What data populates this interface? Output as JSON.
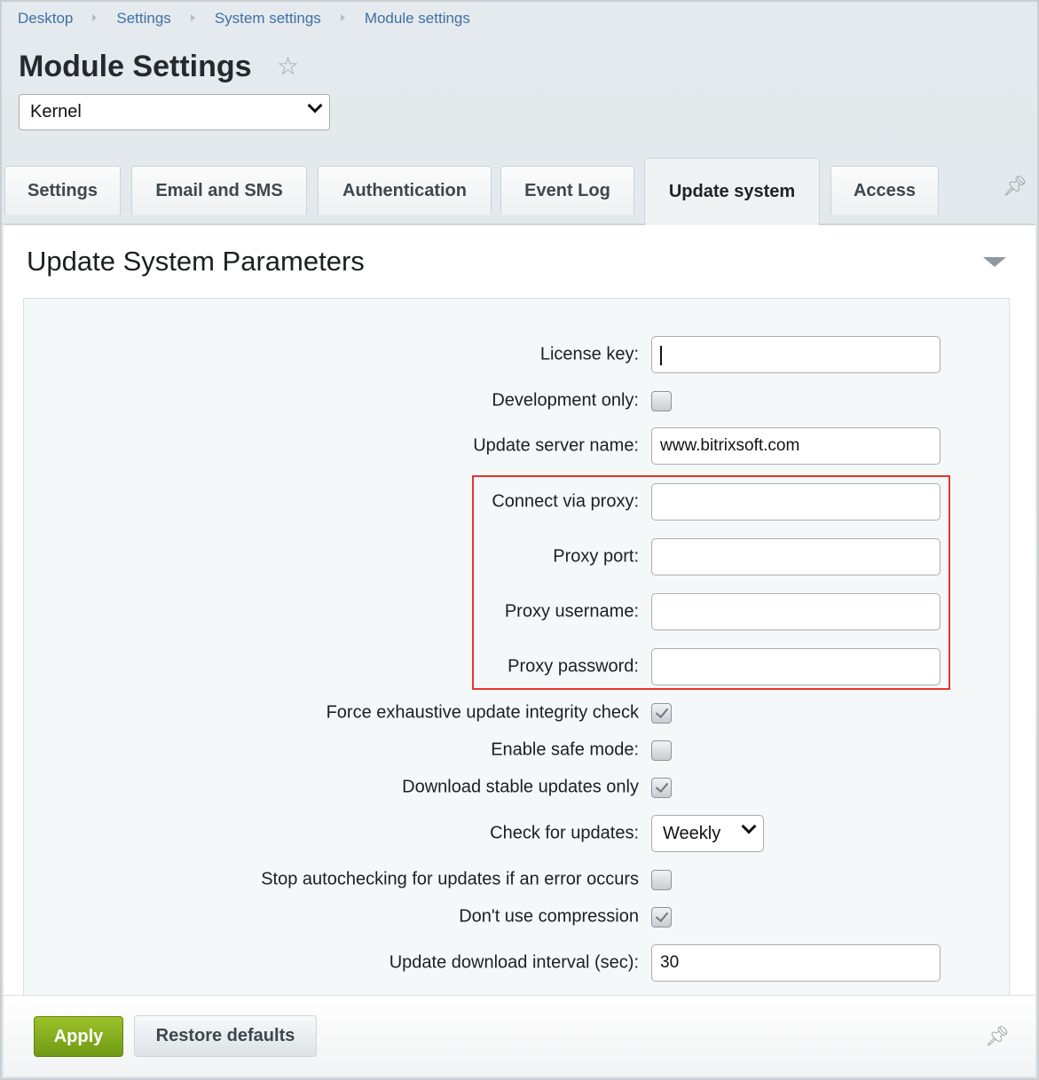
{
  "breadcrumb": [
    "Desktop",
    "Settings",
    "System settings",
    "Module settings"
  ],
  "header": {
    "title": "Module Settings",
    "module_select": "Kernel"
  },
  "tabs": [
    {
      "label": "Settings",
      "active": false
    },
    {
      "label": "Email and SMS",
      "active": false
    },
    {
      "label": "Authentication",
      "active": false
    },
    {
      "label": "Event Log",
      "active": false
    },
    {
      "label": "Update system",
      "active": true
    },
    {
      "label": "Access",
      "active": false
    }
  ],
  "section": {
    "title": "Update System Parameters"
  },
  "fields": [
    {
      "label": "License key:",
      "type": "text",
      "value": ""
    },
    {
      "label": "Development only:",
      "type": "checkbox",
      "checked": false
    },
    {
      "label": "Update server name:",
      "type": "text",
      "value": "www.bitrixsoft.com"
    },
    {
      "label": "Connect via proxy:",
      "type": "text",
      "value": ""
    },
    {
      "label": "Proxy port:",
      "type": "text",
      "value": ""
    },
    {
      "label": "Proxy username:",
      "type": "text",
      "value": ""
    },
    {
      "label": "Proxy password:",
      "type": "text",
      "value": ""
    },
    {
      "label": "Force exhaustive update integrity check",
      "type": "checkbox",
      "checked": true
    },
    {
      "label": "Enable safe mode:",
      "type": "checkbox",
      "checked": false
    },
    {
      "label": "Download stable updates only",
      "type": "checkbox",
      "checked": true
    },
    {
      "label": "Check for updates:",
      "type": "select",
      "value": "Weekly"
    },
    {
      "label": "Stop autochecking for updates if an error occurs",
      "type": "checkbox",
      "checked": false
    },
    {
      "label": "Don't use compression",
      "type": "checkbox",
      "checked": true
    },
    {
      "label": "Update download interval (sec):",
      "type": "text",
      "value": "30"
    }
  ],
  "highlight_color": "#e8352b",
  "footer": {
    "apply": "Apply",
    "restore": "Restore defaults"
  }
}
